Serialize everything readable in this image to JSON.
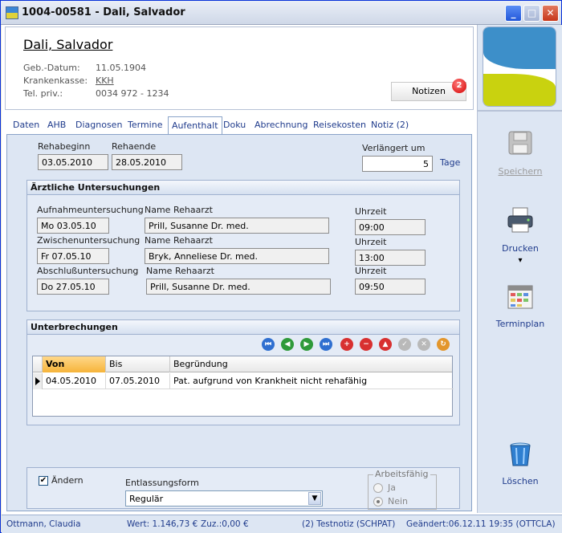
{
  "window": {
    "title": "1004-00581 - Dali, Salvador",
    "buttons": {
      "minimize": "_",
      "maximize": "□",
      "close": "✕"
    }
  },
  "patient": {
    "name": "Dali, Salvador",
    "fields": [
      {
        "label": "Geb.-Datum:",
        "value": "11.05.1904"
      },
      {
        "label": "Krankenkasse:",
        "value": "KKH"
      },
      {
        "label": "Tel. priv.:",
        "value": "0034 972 - 1234"
      }
    ],
    "notizen_label": "Notizen",
    "notizen_count": "2"
  },
  "tabs": [
    "Daten",
    "AHB",
    "Diagnosen",
    "Termine",
    "Aufenthalt",
    "Doku",
    "Abrechnung",
    "Reisekosten",
    "Notiz (2)"
  ],
  "active_tab": "Aufenthalt",
  "aufenthalt": {
    "rehabeginn_label": "Rehabeginn",
    "rehabeginn": "03.05.2010",
    "rehaende_label": "Rehaende",
    "rehaende": "28.05.2010",
    "verlaengert_label": "Verlängert um",
    "verlaengert": "5",
    "tage_label": "Tage"
  },
  "untersuchungen": {
    "title": "Ärztliche Untersuchungen",
    "rows": [
      {
        "type": "Aufnahmeuntersuchung",
        "date": "Mo 03.05.10",
        "arzt_label": "Name Rehaarzt",
        "arzt": "Prill, Susanne Dr. med.",
        "time_label": "Uhrzeit",
        "time": "09:00"
      },
      {
        "type": "Zwischenuntersuchung",
        "date": "Fr 07.05.10",
        "arzt_label": "Name Rehaarzt",
        "arzt": "Bryk, Anneliese Dr. med.",
        "time_label": "Uhrzeit",
        "time": "13:00"
      },
      {
        "type": "Abschlußuntersuchung",
        "date": "Do 27.05.10",
        "arzt_label": "Name Rehaarzt",
        "arzt": "Prill, Susanne Dr. med.",
        "time_label": "Uhrzeit",
        "time": "09:50"
      }
    ]
  },
  "unterbrechungen": {
    "title": "Unterbrechungen",
    "columns": [
      "Von",
      "Bis",
      "Begründung"
    ],
    "rows": [
      {
        "von": "04.05.2010",
        "bis": "07.05.2010",
        "begruendung": "Pat. aufgrund von Krankheit nicht rehafähig"
      }
    ]
  },
  "bottom": {
    "aendern_label": "Ändern",
    "aendern_checked": "✔",
    "entlassung_label": "Entlassungsform",
    "entlassung_value": "Regulär",
    "arbeitsfaehig_label": "Arbeitsfähig",
    "ja_label": "Ja",
    "nein_label": "Nein"
  },
  "sidebar": {
    "speichern": "Speichern",
    "drucken": "Drucken",
    "drucken_arrow": "▾",
    "terminplan": "Terminplan",
    "loeschen": "Löschen"
  },
  "status": {
    "user": "Ottmann, Claudia",
    "wert": "Wert: 1.146,73 €",
    "zuz": "Zuz.:0,00 €",
    "notiz": "(2) Testnotiz (SCHPAT)",
    "geaendert": "Geändert:06.12.11 19:35 (OTTCLA)"
  }
}
